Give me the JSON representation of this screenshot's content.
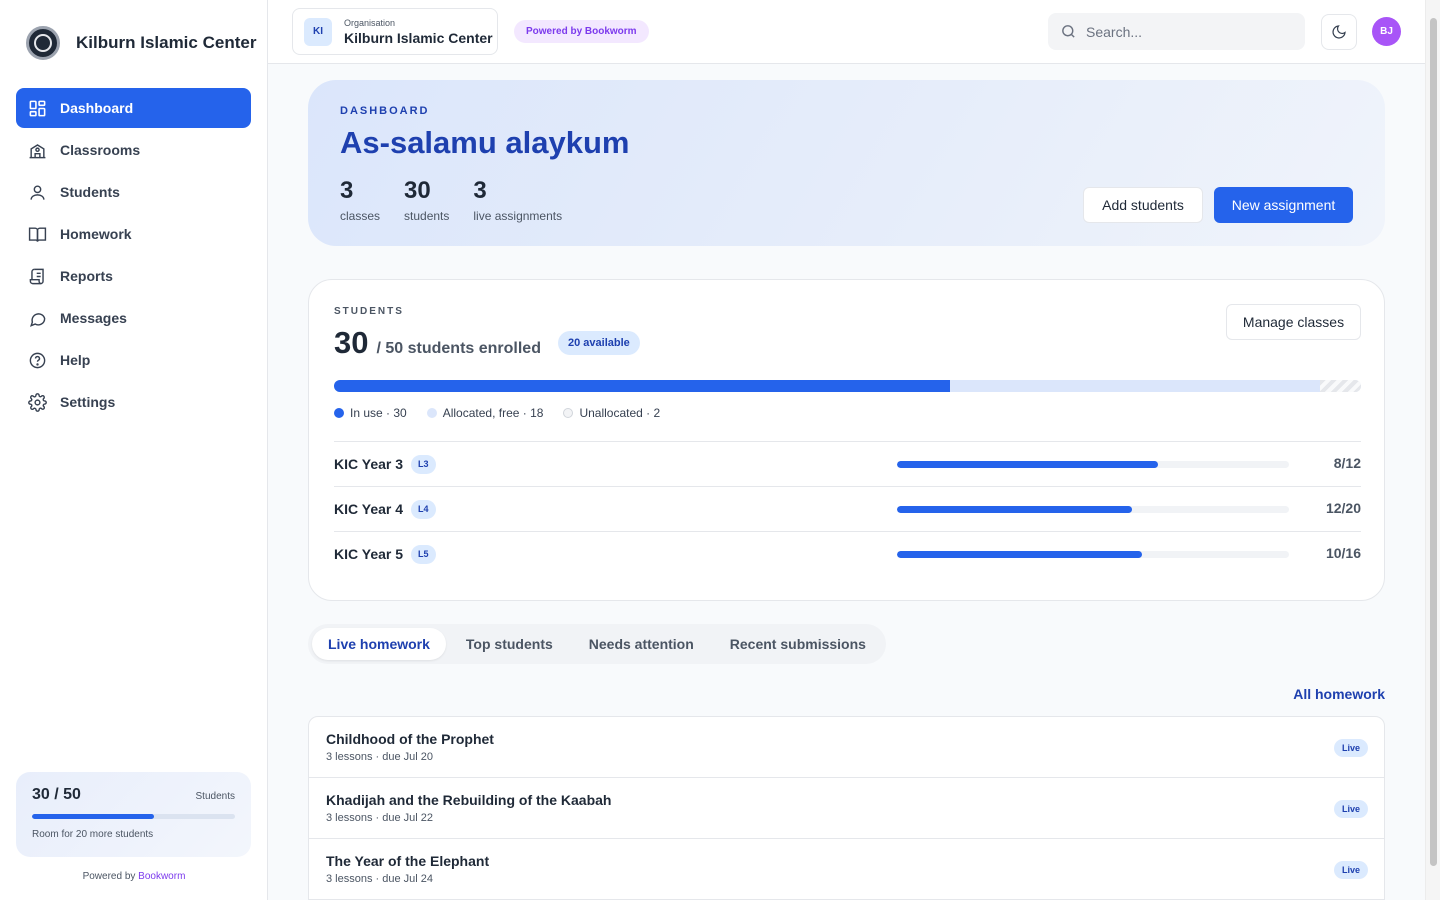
{
  "sidebar": {
    "brand_name": "Kilburn Islamic Center",
    "items": [
      {
        "label": "Dashboard",
        "icon": "grid-icon"
      },
      {
        "label": "Classrooms",
        "icon": "school-icon"
      },
      {
        "label": "Students",
        "icon": "user-icon"
      },
      {
        "label": "Homework",
        "icon": "book-icon"
      },
      {
        "label": "Reports",
        "icon": "scroll-icon"
      },
      {
        "label": "Messages",
        "icon": "chat-icon"
      },
      {
        "label": "Help",
        "icon": "help-icon"
      },
      {
        "label": "Settings",
        "icon": "gear-icon"
      }
    ],
    "usage": {
      "count": "30 / 50",
      "label": "Students",
      "fraction": 0.6,
      "note": "Room for 20 more students"
    },
    "powered_prefix": "Powered by",
    "powered_brand": "Bookworm"
  },
  "topbar": {
    "org_badge": "KI",
    "org_kicker": "Organisation",
    "org_name": "Kilburn Islamic Center",
    "powered_pill": "Powered by Bookworm",
    "search_placeholder": "Search...",
    "avatar_initials": "BJ"
  },
  "hero": {
    "kicker": "DASHBOARD",
    "title": "As-salamu alaykum",
    "stats": [
      {
        "value": "3",
        "label": "classes"
      },
      {
        "value": "30",
        "label": "students"
      },
      {
        "value": "3",
        "label": "live assignments"
      }
    ],
    "add_students_label": "Add students",
    "new_assignment_label": "New assignment"
  },
  "students_card": {
    "kicker": "STUDENTS",
    "enrolled": "30",
    "enrolled_of": "/ 50 students enrolled",
    "available_pill": "20 available",
    "manage_label": "Manage classes",
    "capacity": {
      "in_use": 30,
      "allocated_free": 18,
      "unallocated": 2,
      "total": 50
    },
    "legend": [
      {
        "label": "In use · 30"
      },
      {
        "label": "Allocated, free · 18"
      },
      {
        "label": "Unallocated · 2"
      }
    ],
    "classes": [
      {
        "name": "KIC Year 3",
        "level": "L3",
        "fraction": 0.667,
        "frac_label": "8/12"
      },
      {
        "name": "KIC Year 4",
        "level": "L4",
        "fraction": 0.6,
        "frac_label": "12/20"
      },
      {
        "name": "KIC Year 5",
        "level": "L5",
        "fraction": 0.625,
        "frac_label": "10/16"
      }
    ]
  },
  "tabs": [
    "Live homework",
    "Top students",
    "Needs attention",
    "Recent submissions"
  ],
  "all_homework_label": "All homework",
  "homework": [
    {
      "title": "Childhood of the Prophet",
      "meta": "3 lessons · due Jul 20",
      "status": "Live"
    },
    {
      "title": "Khadijah and the Rebuilding of the Kaabah",
      "meta": "3 lessons · due Jul 22",
      "status": "Live"
    },
    {
      "title": "The Year of the Elephant",
      "meta": "3 lessons · due Jul 24",
      "status": "Live"
    }
  ],
  "colors": {
    "accent": "#2563eb",
    "accent_dark": "#1e40af",
    "brand_purple": "#7c3aed"
  }
}
